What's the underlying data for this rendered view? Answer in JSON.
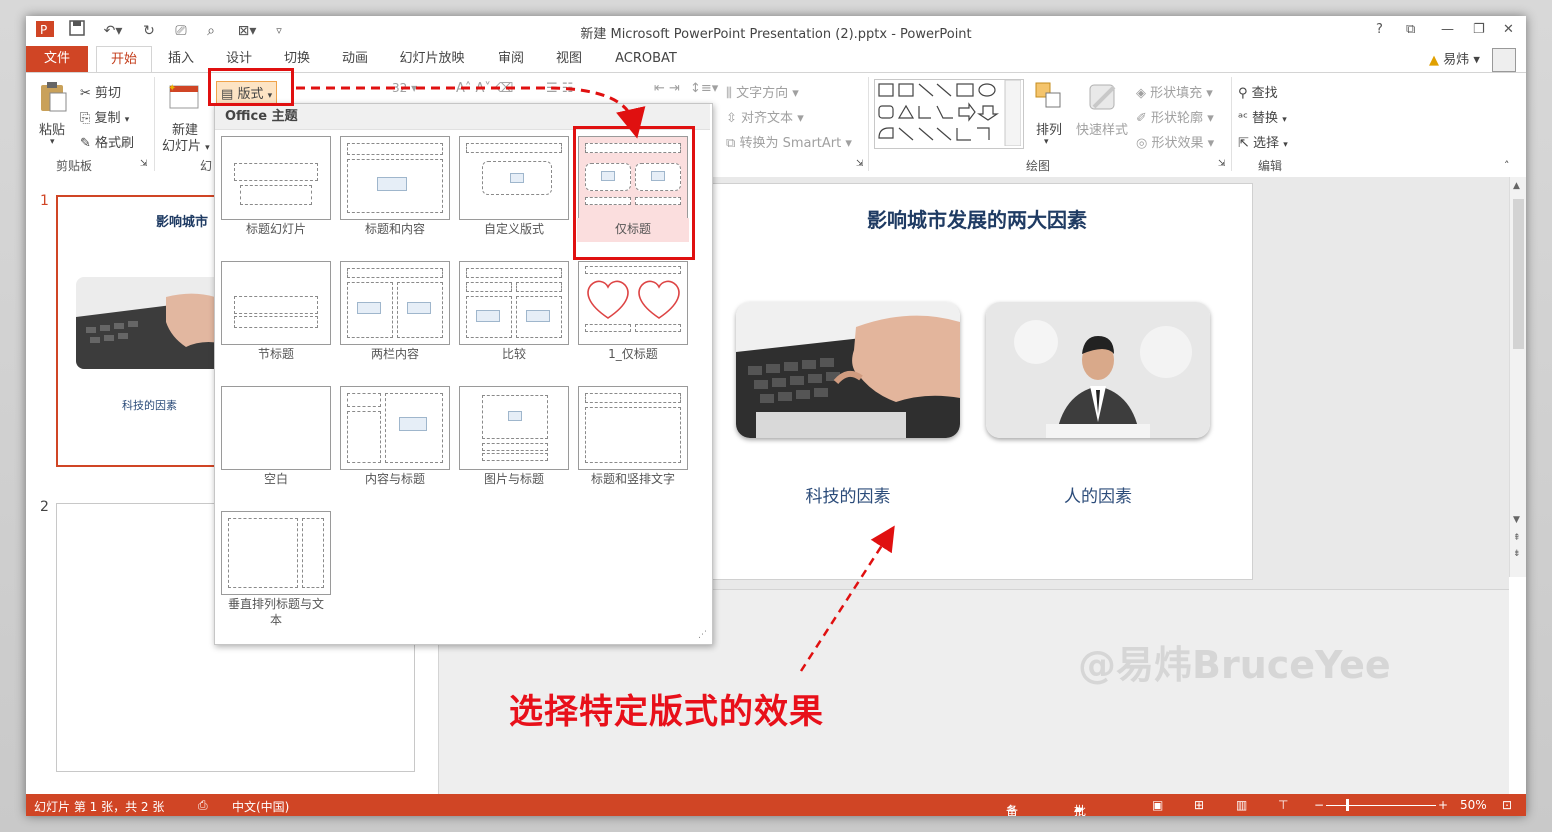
{
  "window": {
    "title": "新建 Microsoft PowerPoint Presentation (2).pptx - PowerPoint"
  },
  "window_controls": {
    "help": "?",
    "ribbon_display": "⧉",
    "minimize": "—",
    "restore": "❐",
    "close": "✕"
  },
  "user": {
    "name": "易炜",
    "warning_icon": "warning-icon"
  },
  "tabs": [
    {
      "label": "文件"
    },
    {
      "label": "开始"
    },
    {
      "label": "插入"
    },
    {
      "label": "设计"
    },
    {
      "label": "切换"
    },
    {
      "label": "动画"
    },
    {
      "label": "幻灯片放映"
    },
    {
      "label": "审阅"
    },
    {
      "label": "视图"
    },
    {
      "label": "ACROBAT"
    }
  ],
  "ribbon": {
    "clipboard": {
      "paste": "粘贴",
      "cut": "剪切",
      "copy": "复制",
      "format_painter": "格式刷",
      "group": "剪贴板"
    },
    "slides": {
      "new_slide": "新建",
      "new_slide2": "幻灯片",
      "layout": "版式",
      "group": "幻"
    },
    "font": {
      "size": "32"
    },
    "paragraph": {
      "text_direction": "文字方向",
      "align_text": "对齐文本",
      "smartart": "转换为 SmartArt"
    },
    "drawing": {
      "arrange": "排列",
      "quick_styles": "快速样式",
      "fill": "形状填充",
      "outline": "形状轮廓",
      "effects": "形状效果",
      "group": "绘图"
    },
    "editing": {
      "find": "查找",
      "replace": "替换",
      "select": "选择",
      "group": "编辑"
    }
  },
  "layout_dropdown": {
    "header": "Office 主题",
    "layouts": [
      {
        "label": "标题幻灯片"
      },
      {
        "label": "标题和内容"
      },
      {
        "label": "自定义版式"
      },
      {
        "label": "仅标题"
      },
      {
        "label": "节标题"
      },
      {
        "label": "两栏内容"
      },
      {
        "label": "比较"
      },
      {
        "label": "1_仅标题"
      },
      {
        "label": "空白"
      },
      {
        "label": "内容与标题"
      },
      {
        "label": "图片与标题"
      },
      {
        "label": "标题和竖排文字"
      },
      {
        "label": "垂直排列标题与文",
        "label2": "本"
      }
    ]
  },
  "slides_pane": {
    "slide1": {
      "num": "1",
      "title": "影响城市",
      "caption": "科技的因素"
    },
    "slide2": {
      "num": "2"
    }
  },
  "slide": {
    "title": "影响城市发展的两大因素",
    "captions": [
      "科技的因素",
      "人的因素"
    ]
  },
  "status": {
    "slide_info": "幻灯片 第 1 张，共 2 张",
    "language": "中文(中国)",
    "notes": "备注",
    "comments": "批注",
    "zoom": "50%"
  },
  "annotation": {
    "text": "选择特定版式的效果"
  },
  "watermark": {
    "text": "@易炜BruceYee"
  },
  "colors": {
    "accent": "#d04525",
    "highlight": "#e01010",
    "title": "#1f3b63"
  }
}
